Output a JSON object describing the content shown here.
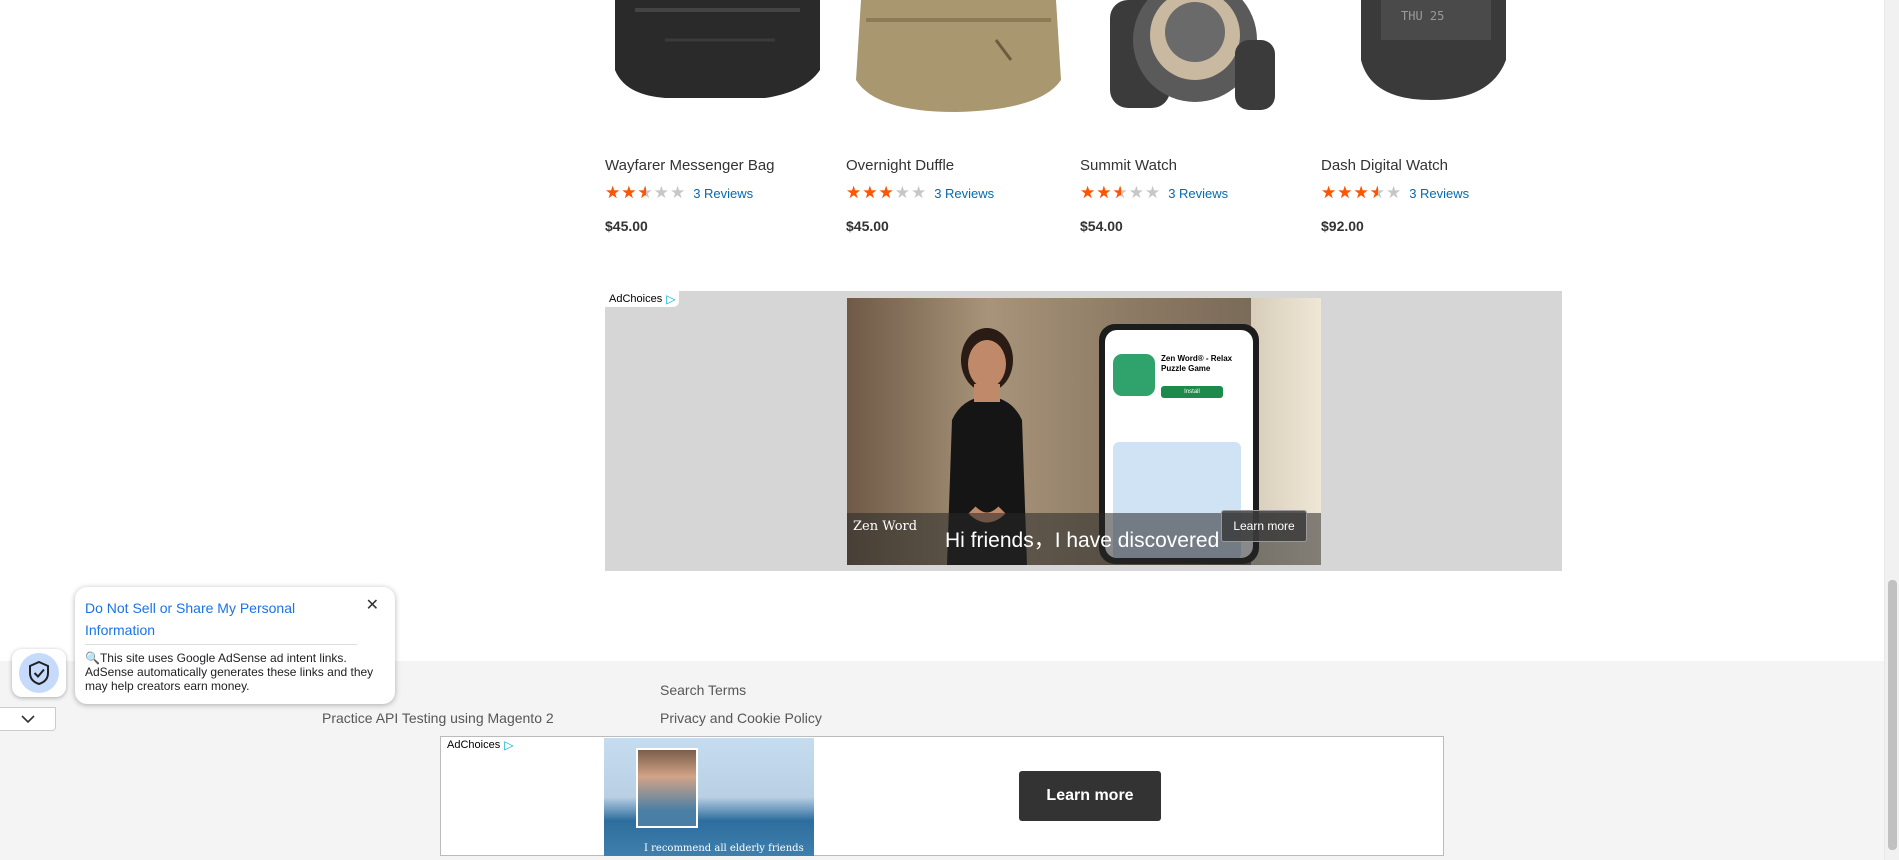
{
  "products": [
    {
      "name": "Wayfarer Messenger Bag",
      "rating_fraction": 0.5,
      "reviews": "3 Reviews",
      "price": "$45.00"
    },
    {
      "name": "Overnight Duffle",
      "rating_fraction": 0.6,
      "reviews": "3 Reviews",
      "price": "$45.00"
    },
    {
      "name": "Summit Watch",
      "rating_fraction": 0.5,
      "reviews": "3 Reviews",
      "price": "$54.00"
    },
    {
      "name": "Dash Digital Watch",
      "rating_fraction": 0.7,
      "reviews": "3 Reviews",
      "price": "$92.00"
    }
  ],
  "stars": "★★★★★",
  "ad_banner": {
    "adchoices": "AdChoices",
    "app_title": "Zen Word® - Relax Puzzle Game",
    "app_install": "Install",
    "caption": "Hi friends，I have discovered",
    "logo": "Zen Word",
    "learn_more": "Learn more"
  },
  "privacy_popup": {
    "title": "Do Not Sell or Share My Personal Information",
    "close": "✕",
    "body": "🔍This site uses Google AdSense ad intent links. AdSense automatically generates these links and they may help creators earn money."
  },
  "footer": {
    "links": [
      "Search Terms",
      "Practice API Testing using Magento 2",
      "Privacy and Cookie Policy"
    ]
  },
  "anchor_ad": {
    "adchoices": "AdChoices",
    "caption": "I recommend all elderly friends",
    "learn_more": "Learn more"
  },
  "colors": {
    "star": "#ff5501",
    "link": "#006bb4",
    "privacy_title": "#1a73e8"
  }
}
